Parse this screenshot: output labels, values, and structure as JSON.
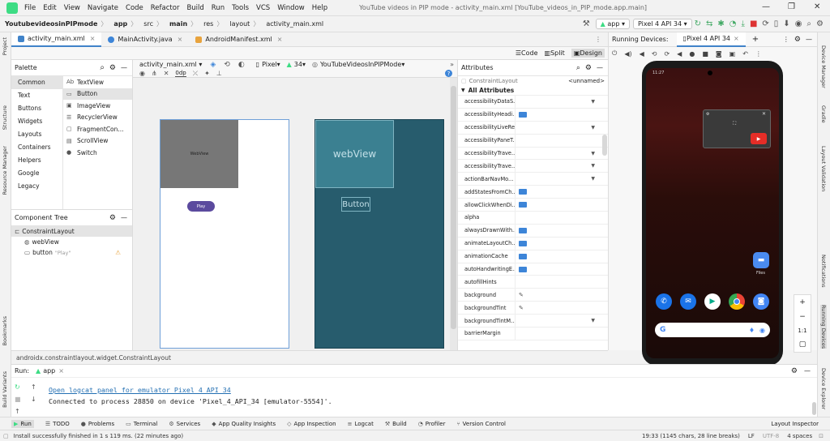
{
  "menu": {
    "items": [
      "File",
      "Edit",
      "View",
      "Navigate",
      "Code",
      "Refactor",
      "Build",
      "Run",
      "Tools",
      "VCS",
      "Window",
      "Help"
    ],
    "title": "YouTube videos in PIP mode - activity_main.xml [YouTube_videos_in_PIP_mode.app.main]"
  },
  "nav": {
    "crumbs": [
      "YoutubevideosinPIPmode",
      "app",
      "src",
      "main",
      "res",
      "layout",
      "activity_main.xml"
    ],
    "run_config": "app",
    "device": "Pixel 4 API 34"
  },
  "editor_tabs": [
    {
      "label": "activity_main.xml",
      "color": "#4083c9"
    },
    {
      "label": "MainActivity.java",
      "color": "#3d85d8"
    },
    {
      "label": "AndroidManifest.xml",
      "color": "#e8a33d"
    }
  ],
  "modes": {
    "code": "Code",
    "split": "Split",
    "design": "Design"
  },
  "palette": {
    "title": "Palette",
    "categories": [
      "Common",
      "Text",
      "Buttons",
      "Widgets",
      "Layouts",
      "Containers",
      "Helpers",
      "Google",
      "Legacy"
    ],
    "components": [
      {
        "icon": "Ab",
        "label": "TextView"
      },
      {
        "icon": "▭",
        "label": "Button"
      },
      {
        "icon": "▣",
        "label": "ImageView"
      },
      {
        "icon": "☰",
        "label": "RecyclerView"
      },
      {
        "icon": "▢",
        "label": "FragmentCon..."
      },
      {
        "icon": "▤",
        "label": "ScrollView"
      },
      {
        "icon": "●",
        "label": "Switch"
      }
    ]
  },
  "tree": {
    "title": "Component Tree",
    "root": "ConstraintLayout",
    "children": [
      {
        "label": "webView",
        "extra": ""
      },
      {
        "label": "button",
        "extra": "\"Play\""
      }
    ]
  },
  "canvas": {
    "file": "activity_main.xml",
    "margin": "0dp",
    "device": "Pixel",
    "api": "34",
    "theme": "YouTubeVideosInPIPMode",
    "webview_label": "WebView",
    "play_label": "Play",
    "blueprint_webview": "webView",
    "blueprint_button": "Button"
  },
  "attributes": {
    "title": "Attributes",
    "search_placeholder": "ConstraintLayout",
    "unnamed": "<unnamed>",
    "section": "All Attributes",
    "rows": [
      {
        "name": "accessibilityDataS...",
        "kind": "dropdown"
      },
      {
        "name": "accessibilityHeadi...",
        "kind": "flag"
      },
      {
        "name": "accessibilityLiveRe...",
        "kind": "dropdown"
      },
      {
        "name": "accessibilityPaneT...",
        "kind": "none"
      },
      {
        "name": "accessibilityTrave...",
        "kind": "dropdown"
      },
      {
        "name": "accessibilityTrave...",
        "kind": "dropdown"
      },
      {
        "name": "actionBarNavMo...",
        "kind": "dropdown"
      },
      {
        "name": "addStatesFromCh...",
        "kind": "flag"
      },
      {
        "name": "allowClickWhenDi...",
        "kind": "flag"
      },
      {
        "name": "alpha",
        "kind": "none"
      },
      {
        "name": "alwaysDrawnWith...",
        "kind": "flag"
      },
      {
        "name": "animateLayoutCh...",
        "kind": "flag"
      },
      {
        "name": "animationCache",
        "kind": "flag"
      },
      {
        "name": "autoHandwritingE...",
        "kind": "flag"
      },
      {
        "name": "autofillHints",
        "kind": "none"
      },
      {
        "name": "background",
        "kind": "picker"
      },
      {
        "name": "backgroundTint",
        "kind": "picker"
      },
      {
        "name": "backgroundTintM...",
        "kind": "dropdown"
      },
      {
        "name": "barrierMargin",
        "kind": "none"
      }
    ]
  },
  "running_devices": {
    "title": "Running Devices:",
    "tab": "Pixel 4 API 34",
    "time": "11:27",
    "files_label": "Files"
  },
  "status": {
    "path": "androidx.constraintlayout.widget.ConstraintLayout"
  },
  "run": {
    "label": "Run:",
    "config": "app",
    "link": "Open logcat panel for emulator Pixel 4 API 34",
    "message": "Connected to process 28850 on device 'Pixel_4_API_34 [emulator-5554]'."
  },
  "bottom_tools": [
    {
      "icon": "▶",
      "label": "Run"
    },
    {
      "icon": "☰",
      "label": "TODO"
    },
    {
      "icon": "●",
      "label": "Problems"
    },
    {
      "icon": "▭",
      "label": "Terminal"
    },
    {
      "icon": "⚙",
      "label": "Services"
    },
    {
      "icon": "◆",
      "label": "App Quality Insights"
    },
    {
      "icon": "◇",
      "label": "App Inspection"
    },
    {
      "icon": "≡",
      "label": "Logcat"
    },
    {
      "icon": "⚒",
      "label": "Build"
    },
    {
      "icon": "◔",
      "label": "Profiler"
    },
    {
      "icon": "⑂",
      "label": "Version Control"
    }
  ],
  "layout_inspector": "Layout Inspector",
  "statusbar": {
    "message": "Install successfully finished in 1 s 119 ms. (22 minutes ago)",
    "position": "19:33 (1145 chars, 28 line breaks)",
    "lf": "LF",
    "encoding": "UTF-8",
    "indent": "4 spaces"
  },
  "left_strip": [
    "Project",
    "Structure",
    "Resource Manager",
    "Bookmarks",
    "Build Variants"
  ],
  "right_strip": [
    "Device Manager",
    "Gradle",
    "Layout Validation",
    "Notifications",
    "Running Devices",
    "Device Explorer"
  ],
  "zoom": {
    "ratio": "1:1"
  }
}
